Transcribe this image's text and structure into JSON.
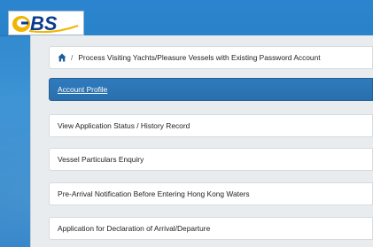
{
  "logo": {
    "text": "eBS"
  },
  "breadcrumb": {
    "home_icon": "home-icon",
    "separator": "/",
    "current": "Process Visiting Yachts/Pleasure Vessels with Existing Password Account"
  },
  "menu": {
    "items": [
      {
        "label": "Account Profile",
        "active": true
      },
      {
        "label": "View Application Status / History Record"
      },
      {
        "label": "Vessel Particulars Enquiry"
      },
      {
        "label": "Pre-Arrival Notification Before Entering Hong Kong Waters"
      },
      {
        "label": "Application for Declaration of Arrival/Departure"
      }
    ]
  },
  "colors": {
    "accent": "#2a6fad",
    "background": "#2f86cc"
  }
}
